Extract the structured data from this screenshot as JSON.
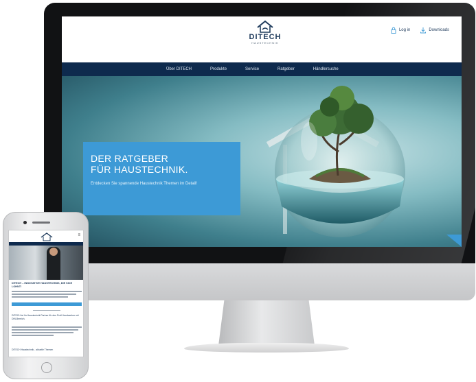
{
  "site": {
    "logo_name": "DITECH",
    "logo_sub": "HAUSTECHNIK",
    "header_links": [
      {
        "label": "Log in",
        "icon": "lock-icon"
      },
      {
        "label": "Downloads",
        "icon": "download-icon"
      }
    ],
    "nav": [
      "Über DITECH",
      "Produkte",
      "Service",
      "Ratgeber",
      "Händlersuche"
    ],
    "hero": {
      "title_line1": "DER RATGEBER",
      "title_line2": "FÜR HAUSTECHNIK.",
      "text": "Entdecken Sie spannende Haustechnik Themen im Detail!"
    },
    "colors": {
      "navy": "#0e2a4d",
      "accent_blue": "#3d9ad6",
      "teal": "#3f7f8c"
    }
  },
  "mobile": {
    "menu_icon": "≡",
    "heading": "DITECH – INNOVATIVE HAUSTECHNIK, DIE SICH LOHNT!",
    "text2": "DITECH ist Ihr Haustechnik Partner für den Profi Handwerker mit DIN-Bereich.",
    "text3": "DITECH Haustechnik - aktuelle Themen"
  }
}
